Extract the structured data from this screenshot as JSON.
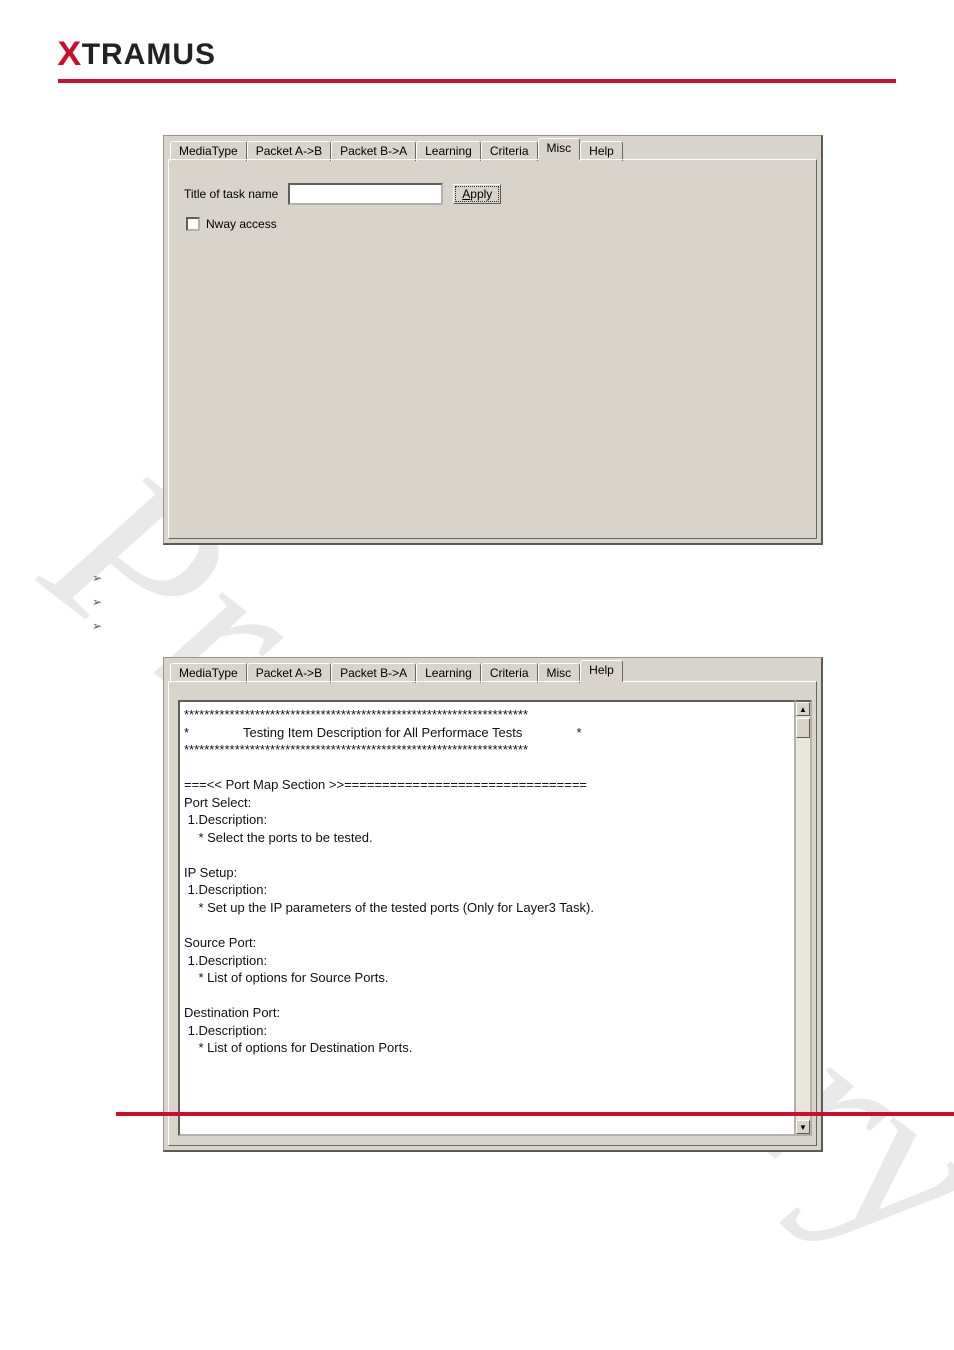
{
  "brand": "XTRAMUS",
  "panel1": {
    "tabs": [
      "MediaType",
      "Packet A->B",
      "Packet B->A",
      "Learning",
      "Criteria",
      "Misc",
      "Help"
    ],
    "active_tab_index": 5,
    "title_label": "Title of task name",
    "title_value": "",
    "apply_btn_pre": "A",
    "apply_btn_rest": "pply",
    "nway_label": "Nway access",
    "nway_checked": false
  },
  "bullets": [
    "",
    "",
    ""
  ],
  "panel2": {
    "tabs": [
      "MediaType",
      "Packet A->B",
      "Packet B->A",
      "Learning",
      "Criteria",
      "Misc",
      "Help"
    ],
    "active_tab_index": 6,
    "help_text_lines": [
      "********************************************************************",
      "*               Testing Item Description for All Performace Tests               *",
      "********************************************************************",
      "",
      "===<< Port Map Section >>================================",
      "Port Select:",
      " 1.Description:",
      "    * Select the ports to be tested.",
      "",
      "IP Setup:",
      " 1.Description:",
      "    * Set up the IP parameters of the tested ports (Only for Layer3 Task).",
      "",
      "Source Port:",
      " 1.Description:",
      "    * List of options for Source Ports.",
      "",
      "Destination Port:",
      " 1.Description:",
      "    * List of options for Destination Ports."
    ]
  }
}
